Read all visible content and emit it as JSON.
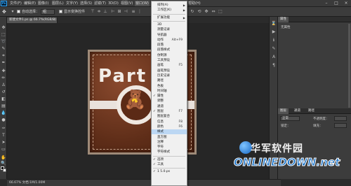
{
  "menubar": {
    "logo": "Ps",
    "items": [
      "文件(F)",
      "编辑(E)",
      "图像(I)",
      "图层(L)",
      "文字(Y)",
      "选择(S)",
      "滤镜(T)",
      "3D(D)",
      "视图(V)",
      "窗口(W)",
      "帮助(H)"
    ],
    "window_controls": [
      "–",
      "□",
      "×"
    ]
  },
  "optbar": {
    "auto_select_label": "自动选择：",
    "auto_select_value": "组",
    "show_transform_label": "显示变换控件"
  },
  "document": {
    "tab_label": "新建文件1.ps @ 66.7%(RGB/8)",
    "status_text": "66.67%     文档:1M/1.00M"
  },
  "artwork": {
    "text": "Part"
  },
  "window_menu": {
    "items": [
      {
        "label": "排列(A)",
        "arrow": true
      },
      {
        "label": "工作区(K)",
        "arrow": true
      },
      {
        "sep": true
      },
      {
        "label": "扩展功能",
        "arrow": true
      },
      {
        "sep": true
      },
      {
        "label": "3D"
      },
      {
        "label": "测量记录"
      },
      {
        "label": "导航器"
      },
      {
        "label": "动作",
        "shortcut": "Alt+F9"
      },
      {
        "label": "段落"
      },
      {
        "label": "段落样式"
      },
      {
        "label": "仿制源"
      },
      {
        "label": "工具预设"
      },
      {
        "label": "画笔",
        "shortcut": "F5"
      },
      {
        "label": "画笔预设"
      },
      {
        "label": "历史记录"
      },
      {
        "label": "路径"
      },
      {
        "label": "色板"
      },
      {
        "label": "时间轴"
      },
      {
        "label": "属性",
        "checked": true
      },
      {
        "label": "调整"
      },
      {
        "label": "通道"
      },
      {
        "label": "图层",
        "shortcut": "F7",
        "checked": true
      },
      {
        "label": "图层复合"
      },
      {
        "label": "信息",
        "shortcut": "F8"
      },
      {
        "label": "颜色",
        "shortcut": "F6"
      },
      {
        "label": "样式",
        "highlight": true
      },
      {
        "label": "直方图"
      },
      {
        "label": "注释"
      },
      {
        "label": "字符"
      },
      {
        "label": "字符样式"
      },
      {
        "sep": true
      },
      {
        "label": "选项",
        "checked": true
      },
      {
        "label": "工具",
        "checked": true
      },
      {
        "sep": true
      },
      {
        "label": "1 5.0.ps",
        "checked": true
      }
    ]
  },
  "panels": {
    "top_tab": "属性",
    "top_label": "无属性",
    "bottom_tabs": [
      "图层",
      "通道",
      "路径"
    ],
    "blend_mode": "正常",
    "opacity_label": "不透明度：",
    "lock_label": "锁定：",
    "fill_label": "填充："
  },
  "watermark": {
    "cn": "华军软件园",
    "en": "ONLINEDOWN.net"
  }
}
